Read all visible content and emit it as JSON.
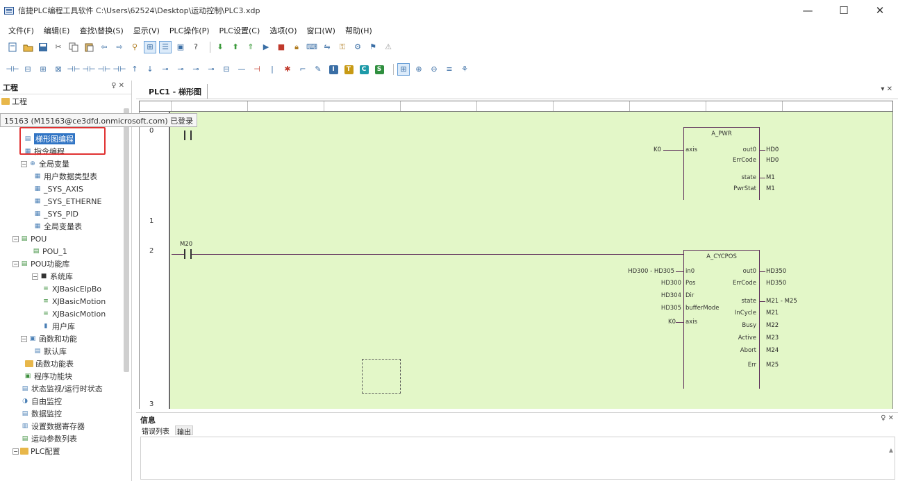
{
  "window": {
    "title": "信捷PLC编程工具软件  C:\\Users\\62524\\Desktop\\运动控制\\PLC3.xdp",
    "minimize": "—",
    "maximize": "☐",
    "close": "✕"
  },
  "menu": [
    "文件(F)",
    "编辑(E)",
    "查找\\替换(S)",
    "显示(V)",
    "PLC操作(P)",
    "PLC设置(C)",
    "选项(O)",
    "窗口(W)",
    "帮助(H)"
  ],
  "toolbar1": [
    "new-file-icon",
    "open-folder-icon",
    "save-icon",
    "cut-icon",
    "copy-icon",
    "paste-icon",
    "undo-icon",
    "redo-icon",
    "find-icon",
    "ladder-view-icon",
    "instruction-view-icon",
    "block-icon",
    "help-icon",
    "download-icon",
    "upload-icon",
    "run-icon",
    "play-icon",
    "stop-icon",
    "lock-icon",
    "monitor-icon",
    "compare-icon",
    "key-icon",
    "tools-icon",
    "flag-icon",
    "warning-icon"
  ],
  "left_panel": {
    "title": "工程",
    "pin": "♀ ✕",
    "root_label": "工程",
    "tooltip": "15163 (M15163@ce3dfd.onmicrosoft.com) 已登录",
    "tree": [
      {
        "label": "梯形图编程",
        "selected": true
      },
      {
        "label": "指令编程"
      },
      {
        "label": "全局变量",
        "expand": "⊟"
      },
      {
        "label": "用户数据类型表"
      },
      {
        "label": "_SYS_AXIS"
      },
      {
        "label": "_SYS_ETHERNE"
      },
      {
        "label": "_SYS_PID"
      },
      {
        "label": "全局变量表"
      },
      {
        "label": "POU",
        "expand": "⊟"
      },
      {
        "label": "POU_1"
      },
      {
        "label": "POU功能库",
        "expand": "⊟"
      },
      {
        "label": "系统库",
        "expand": "⊟"
      },
      {
        "label": "XJBasicElpBo"
      },
      {
        "label": "XJBasicMotion"
      },
      {
        "label": "XJBasicMotion"
      },
      {
        "label": "用户库"
      },
      {
        "label": "函数和功能",
        "expand": "⊟"
      },
      {
        "label": "默认库"
      },
      {
        "label": "函数功能表"
      },
      {
        "label": "程序功能块"
      },
      {
        "label": "状态监视/运行时状态"
      },
      {
        "label": "自由监控"
      },
      {
        "label": "数据监控"
      },
      {
        "label": "设置数据寄存器"
      },
      {
        "label": "运动参数列表"
      },
      {
        "label": "PLC配置",
        "expand": "⊟"
      }
    ]
  },
  "editor": {
    "tab_title": "PLC1 - 梯形图",
    "tab_menu": "▾ ✕",
    "row_numbers": [
      "0",
      "1",
      "2",
      "3"
    ],
    "rung0": {
      "block_title": "A_PWR",
      "in_label": "K0",
      "in_pin": "axis",
      "out_pins": [
        "out0",
        "ErrCode",
        "state",
        "PwrStat"
      ],
      "out_vars": [
        "HD0",
        "HD0",
        "M1",
        "M1"
      ]
    },
    "rung2": {
      "contact_label": "M20",
      "block_title": "A_CYCPOS",
      "in_vars": [
        "HD300 - HD305",
        "HD300",
        "HD304",
        "HD305",
        "K0"
      ],
      "in_pins": [
        "in0",
        "Pos",
        "Dir",
        "bufferMode",
        "axis"
      ],
      "out_pins": [
        "out0",
        "ErrCode",
        "state",
        "InCycle",
        "Busy",
        "Active",
        "Abort",
        "Err"
      ],
      "out_vars": [
        "HD350",
        "HD350",
        "M21 - M25",
        "M21",
        "M22",
        "M23",
        "M24",
        "M25"
      ]
    }
  },
  "bottom_panel": {
    "title": "信息",
    "pin": "♀ ✕",
    "tabs": [
      "错误列表",
      "输出"
    ]
  }
}
